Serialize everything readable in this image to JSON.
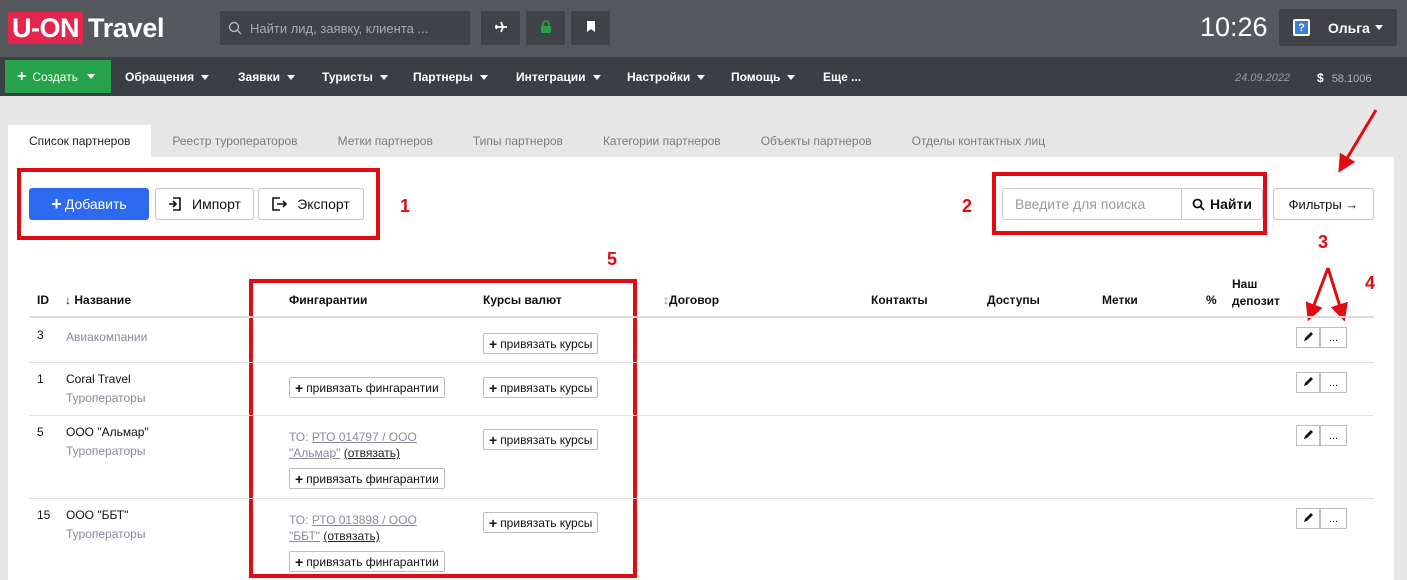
{
  "app": {
    "logo_box": "U-ON",
    "logo_text": "Travel"
  },
  "topbar": {
    "search_placeholder": "Найти лид, заявку, клиента ...",
    "icons": [
      "plane-icon",
      "lock-icon",
      "bookmark-icon"
    ],
    "time": "10:26",
    "user_name": "Ольга"
  },
  "nav": {
    "create_label": "Создать",
    "items": [
      "Обращения",
      "Заявки",
      "Туристы",
      "Партнеры",
      "Интеграции",
      "Настройки",
      "Помощь",
      "Еще ..."
    ],
    "date": "24.09.2022",
    "currency_symbol": "$",
    "balance": "58.1006"
  },
  "tabs": [
    "Список партнеров",
    "Реестр туроператоров",
    "Метки партнеров",
    "Типы партнеров",
    "Категории партнеров",
    "Объекты партнеров",
    "Отделы контактных лиц"
  ],
  "toolbar": {
    "add_label": "Добавить",
    "import_label": "Импорт",
    "export_label": "Экспорт",
    "search_placeholder": "Введите для поиска",
    "find_label": "Найти",
    "filters_label": "Фильтры →"
  },
  "annotations": {
    "n1": "1",
    "n2": "2",
    "n3": "3",
    "n4": "4",
    "n5": "5",
    "accent": "#e10b14"
  },
  "table": {
    "headers": {
      "id": "ID",
      "name": "Название",
      "guarantees": "Фингарантии",
      "rates": "Курсы валют",
      "contract": "Договор",
      "contacts": "Контакты",
      "access": "Доступы",
      "tags": "Метки",
      "percent": "%",
      "deposit_1": "Наш",
      "deposit_2": "депозит"
    },
    "bind_rates": "привязать курсы",
    "bind_guarantees": "привязать фингарантии",
    "unbind": "(отвязать)",
    "edit_icon": "pencil-icon",
    "more_label": "...",
    "rows": [
      {
        "id": "3",
        "name": "",
        "type": "Авиакомпании"
      },
      {
        "id": "1",
        "name": "Coral Travel",
        "type": "Туроператоры"
      },
      {
        "id": "5",
        "name": "ООО \"Альмар\"",
        "type": "Туроператоры",
        "guarantee_prefix": "ТО:",
        "guarantee_link": "РТО 014797 / ООО \"Альмар\""
      },
      {
        "id": "15",
        "name": "ООО \"ББТ\"",
        "type": "Туроператоры",
        "guarantee_prefix": "ТО:",
        "guarantee_link": "РТО 013898 / ООО \"ББТ\""
      }
    ]
  },
  "colors": {
    "primary": "#2d6af0",
    "create_green": "#26a24a",
    "logo_red": "#e2264d",
    "topbar": "#55585d",
    "navbar": "#3b3e42"
  }
}
